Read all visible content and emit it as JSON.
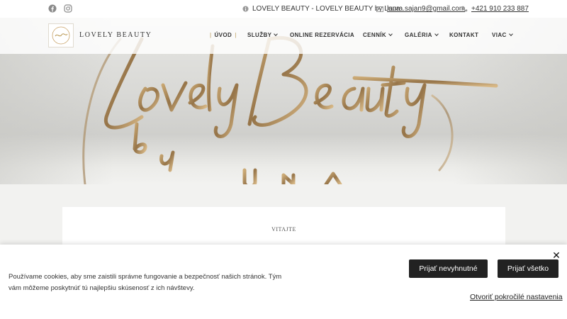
{
  "topbar": {
    "social": [
      {
        "icon": "facebook-icon"
      },
      {
        "icon": "instagram-icon"
      }
    ],
    "business_name": "LOVELY BEAUTY - LOVELY BEAUTY by Luna",
    "email": "laura.sajan9@gmail.com",
    "phone": "+421 910 233 887"
  },
  "brand": {
    "logo_text": "LOVELY BEAUTY",
    "accent_color": "#b8964f"
  },
  "nav": {
    "items": [
      {
        "label": "ÚVOD",
        "active": true,
        "dropdown": false
      },
      {
        "label": "SLUŽBY",
        "active": false,
        "dropdown": true
      },
      {
        "label": "ONLINE REZERVÁCIA",
        "active": false,
        "dropdown": false
      },
      {
        "label": "CENNÍK",
        "active": false,
        "dropdown": true
      },
      {
        "label": "GALÉRIA",
        "active": false,
        "dropdown": true
      },
      {
        "label": "KONTAKT",
        "active": false,
        "dropdown": false
      },
      {
        "label": "VIAC",
        "active": false,
        "dropdown": true
      }
    ]
  },
  "main": {
    "kicker": "VITAJTE"
  },
  "cookie": {
    "text": "Používame cookies, aby sme zaistili správne fungovanie a bezpečnosť našich stránok. Tým vám môžeme poskytnúť tú najlepšiu skúsenosť z ich návštevy.",
    "accept_necessary": "Prijať nevyhnutné",
    "accept_all": "Prijať všetko",
    "advanced_settings": "Otvoriť pokročilé nastavenia",
    "close_icon": "close-icon"
  }
}
